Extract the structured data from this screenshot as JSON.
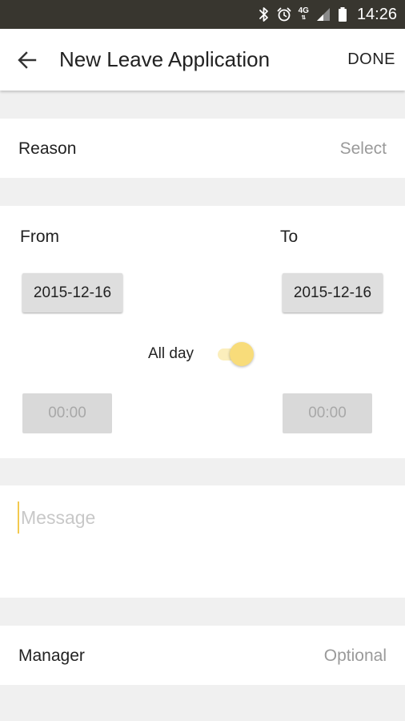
{
  "status_bar": {
    "time": "14:26",
    "network": "4G",
    "icons": [
      "bluetooth-icon",
      "alarm-icon",
      "4g-icon",
      "signal-icon",
      "battery-icon"
    ]
  },
  "app_bar": {
    "title": "New Leave Application",
    "done_label": "DONE",
    "back_icon": "arrow-left-icon"
  },
  "reason": {
    "label": "Reason",
    "value_placeholder": "Select"
  },
  "dates": {
    "from_label": "From",
    "to_label": "To",
    "from_date": "2015-12-16",
    "to_date": "2015-12-16",
    "all_day_label": "All day",
    "all_day_enabled": true,
    "from_time": "00:00",
    "to_time": "00:00"
  },
  "message": {
    "placeholder": "Message",
    "value": ""
  },
  "manager": {
    "label": "Manager",
    "value_placeholder": "Optional"
  },
  "colors": {
    "status_bar": "#38362f",
    "accent": "#f8dc7a",
    "accent_track": "#fbeebc",
    "background": "#f0f0f0"
  }
}
